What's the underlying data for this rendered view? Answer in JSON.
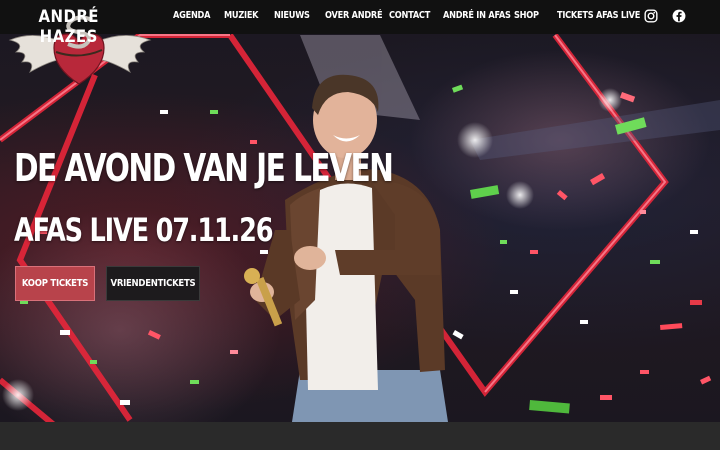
{
  "brand": {
    "name": "ANDRÉ HAZES"
  },
  "nav": {
    "items": [
      {
        "label": "AGENDA"
      },
      {
        "label": "MUZIEK"
      },
      {
        "label": "NIEUWS"
      },
      {
        "label": "OVER ANDRÉ"
      },
      {
        "label": "CONTACT"
      },
      {
        "label": "ANDRÉ IN AFAS"
      },
      {
        "label": "SHOP"
      },
      {
        "label": "TICKETS AFAS LIVE"
      }
    ],
    "social": [
      {
        "icon": "instagram-icon"
      },
      {
        "icon": "facebook-icon"
      }
    ]
  },
  "hero": {
    "headline": "DE AVOND VAN JE LEVEN",
    "subline": "AFAS LIVE 07.11.26",
    "buttons": {
      "buy_label": "KOOP TICKETS",
      "friends_label": "VRIENDENTICKETS"
    }
  },
  "colors": {
    "accent": "#b8434b",
    "nav_bg": "#111111",
    "neon": "#e8263a"
  }
}
